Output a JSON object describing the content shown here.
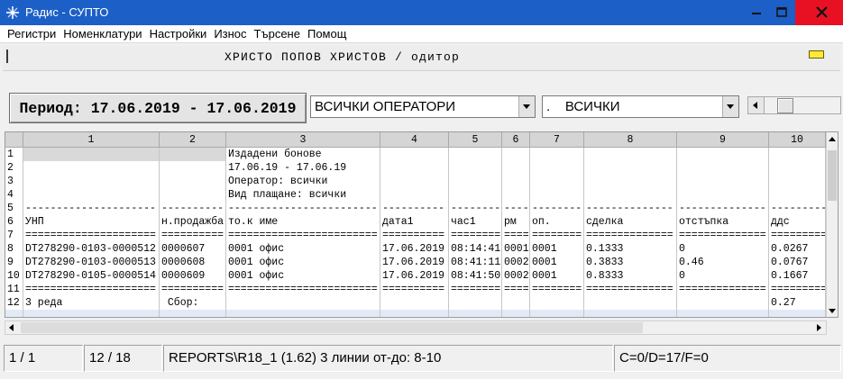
{
  "window": {
    "title": "Радис - СУПТО"
  },
  "menu": {
    "items": [
      "Регистри",
      "Номенклатури",
      "Настройки",
      "Износ",
      "Търсене",
      "Помощ"
    ]
  },
  "header": {
    "user_line": "ХРИСТО ПОПОВ ХРИСТОВ / одитор"
  },
  "toolbar": {
    "period_button": "Период: 17.06.2019 - 17.06.2019",
    "operator_select": "ВСИЧКИ ОПЕРАТОРИ",
    "payment_select": ".    ВСИЧКИ"
  },
  "grid": {
    "columns": [
      "1",
      "2",
      "3",
      "4",
      "5",
      "6",
      "7",
      "8",
      "9",
      "10"
    ],
    "rows": [
      {
        "num": "1",
        "cells": [
          "",
          "",
          "Издадени бонове",
          "",
          "",
          "",
          "",
          "",
          "",
          ""
        ]
      },
      {
        "num": "2",
        "cells": [
          "",
          "",
          "17.06.19 - 17.06.19",
          "",
          "",
          "",
          "",
          "",
          "",
          ""
        ]
      },
      {
        "num": "3",
        "cells": [
          "",
          "",
          "Оператор: всички",
          "",
          "",
          "",
          "",
          "",
          "",
          ""
        ]
      },
      {
        "num": "4",
        "cells": [
          "",
          "",
          "Вид плащане: всички",
          "",
          "",
          "",
          "",
          "",
          "",
          ""
        ]
      },
      {
        "num": "5",
        "cells": [
          "---------------------",
          "----------",
          "------------------------",
          "----------",
          "--------",
          "----",
          "--------",
          "--------------",
          "--------------",
          "---------"
        ]
      },
      {
        "num": "6",
        "cells": [
          "УНП",
          "н.продажба",
          "то.к име",
          "дата1",
          "час1",
          "рм",
          "оп.",
          "сделка",
          "отстъпка",
          "ддс"
        ]
      },
      {
        "num": "7",
        "cells": [
          "=====================",
          "==========",
          "========================",
          "==========",
          "========",
          "====",
          "========",
          "==============",
          "==============",
          "========="
        ]
      },
      {
        "num": "8",
        "cells": [
          "DT278290-0103-0000512",
          "0000607",
          "0001 офис",
          "17.06.2019",
          "08:14:41",
          "0001",
          "0001",
          "0.1333",
          "0",
          "0.0267"
        ]
      },
      {
        "num": "9",
        "cells": [
          "DT278290-0103-0000513",
          "0000608",
          "0001 офис",
          "17.06.2019",
          "08:41:11",
          "0002",
          "0001",
          "0.3833",
          "0.46",
          "0.0767"
        ]
      },
      {
        "num": "10",
        "cells": [
          "DT278290-0105-0000514",
          "0000609",
          "0001 офис",
          "17.06.2019",
          "08:41:50",
          "0002",
          "0001",
          "0.8333",
          "0",
          "0.1667"
        ]
      },
      {
        "num": "11",
        "cells": [
          "=====================",
          "==========",
          "========================",
          "==========",
          "========",
          "====",
          "========",
          "==============",
          "==============",
          "========="
        ]
      },
      {
        "num": "12",
        "cells": [
          "3 реда",
          " Сбор:",
          "",
          "",
          "",
          "",
          "",
          "",
          "",
          "0.27"
        ]
      }
    ]
  },
  "status": {
    "page": "1 / 1",
    "position": "12 / 18",
    "report": "REPORTS\\R18_1 (1.62) 3 линии от-до: 8-10",
    "flags": "C=0/D=17/F=0"
  },
  "icons": {
    "app": "app-star-icon",
    "minimize": "minimize-icon",
    "maximize": "maximize-icon",
    "close": "close-icon",
    "dropdown": "chevron-down-icon",
    "scroll_left": "arrow-left-icon",
    "scroll_right": "arrow-right-icon",
    "scroll_up": "arrow-up-icon",
    "scroll_down": "arrow-down-icon",
    "indicator": "status-indicator-icon"
  },
  "colors": {
    "title_bar": "#1c5fc6",
    "close_button": "#e81123",
    "indicator": "#ffe93b",
    "current_row": "#e2eaf8"
  }
}
